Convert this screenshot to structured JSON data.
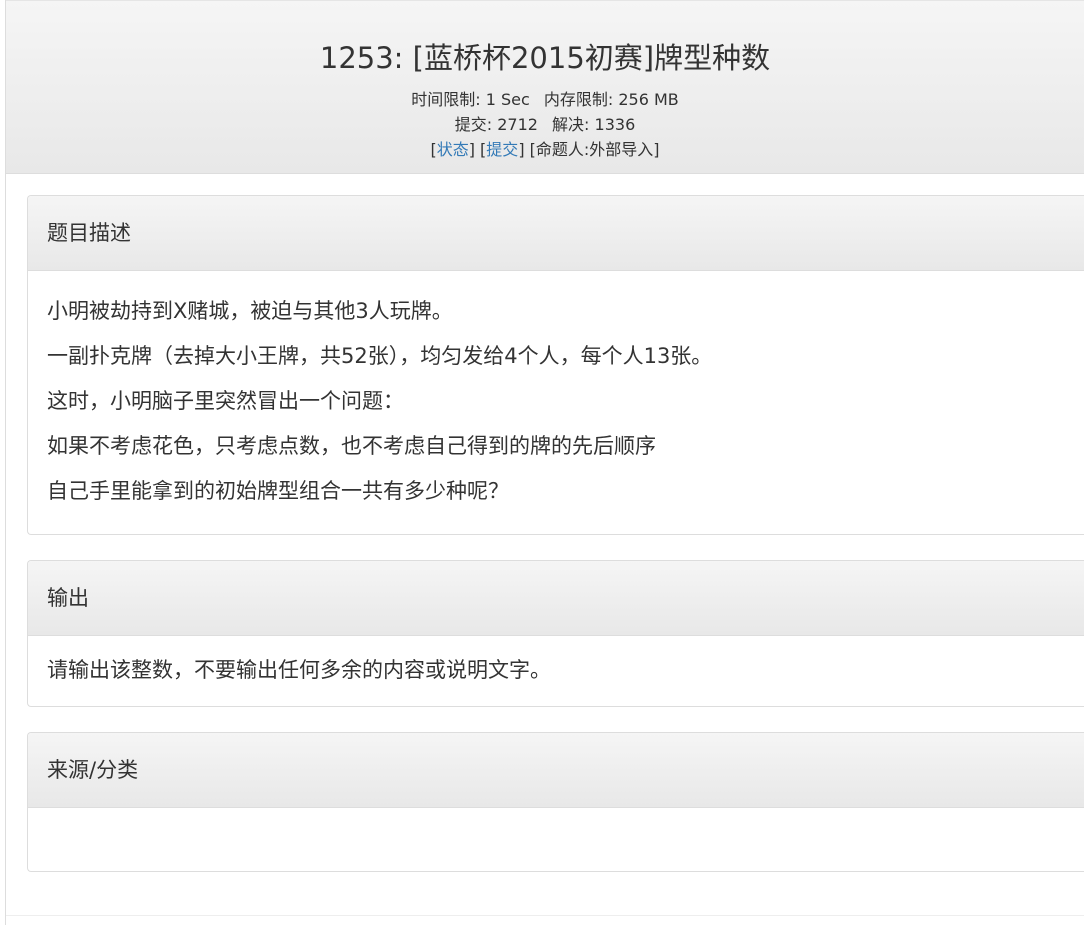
{
  "problem": {
    "title": "1253: [蓝桥杯2015初赛]牌型种数",
    "time_limit_label": "时间限制:",
    "time_limit_value": "1 Sec",
    "memory_limit_label": "内存限制:",
    "memory_limit_value": "256 MB",
    "submit_label": "提交:",
    "submit_count": "2712",
    "solved_label": "解决:",
    "solved_count": "1336",
    "status_link": "状态",
    "submit_link": "提交",
    "author_label": "命题人:外部导入"
  },
  "sections": {
    "description": {
      "heading": "题目描述",
      "lines": [
        "小明被劫持到X赌城，被迫与其他3人玩牌。",
        "一副扑克牌（去掉大小王牌，共52张），均匀发给4个人，每个人13张。",
        "这时，小明脑子里突然冒出一个问题：",
        "如果不考虑花色，只考虑点数，也不考虑自己得到的牌的先后顺序",
        "自己手里能拿到的初始牌型组合一共有多少种呢？"
      ]
    },
    "output": {
      "heading": "输出",
      "text": "请输出该整数，不要输出任何多余的内容或说明文字。"
    },
    "source": {
      "heading": "来源/分类",
      "text": ""
    }
  }
}
